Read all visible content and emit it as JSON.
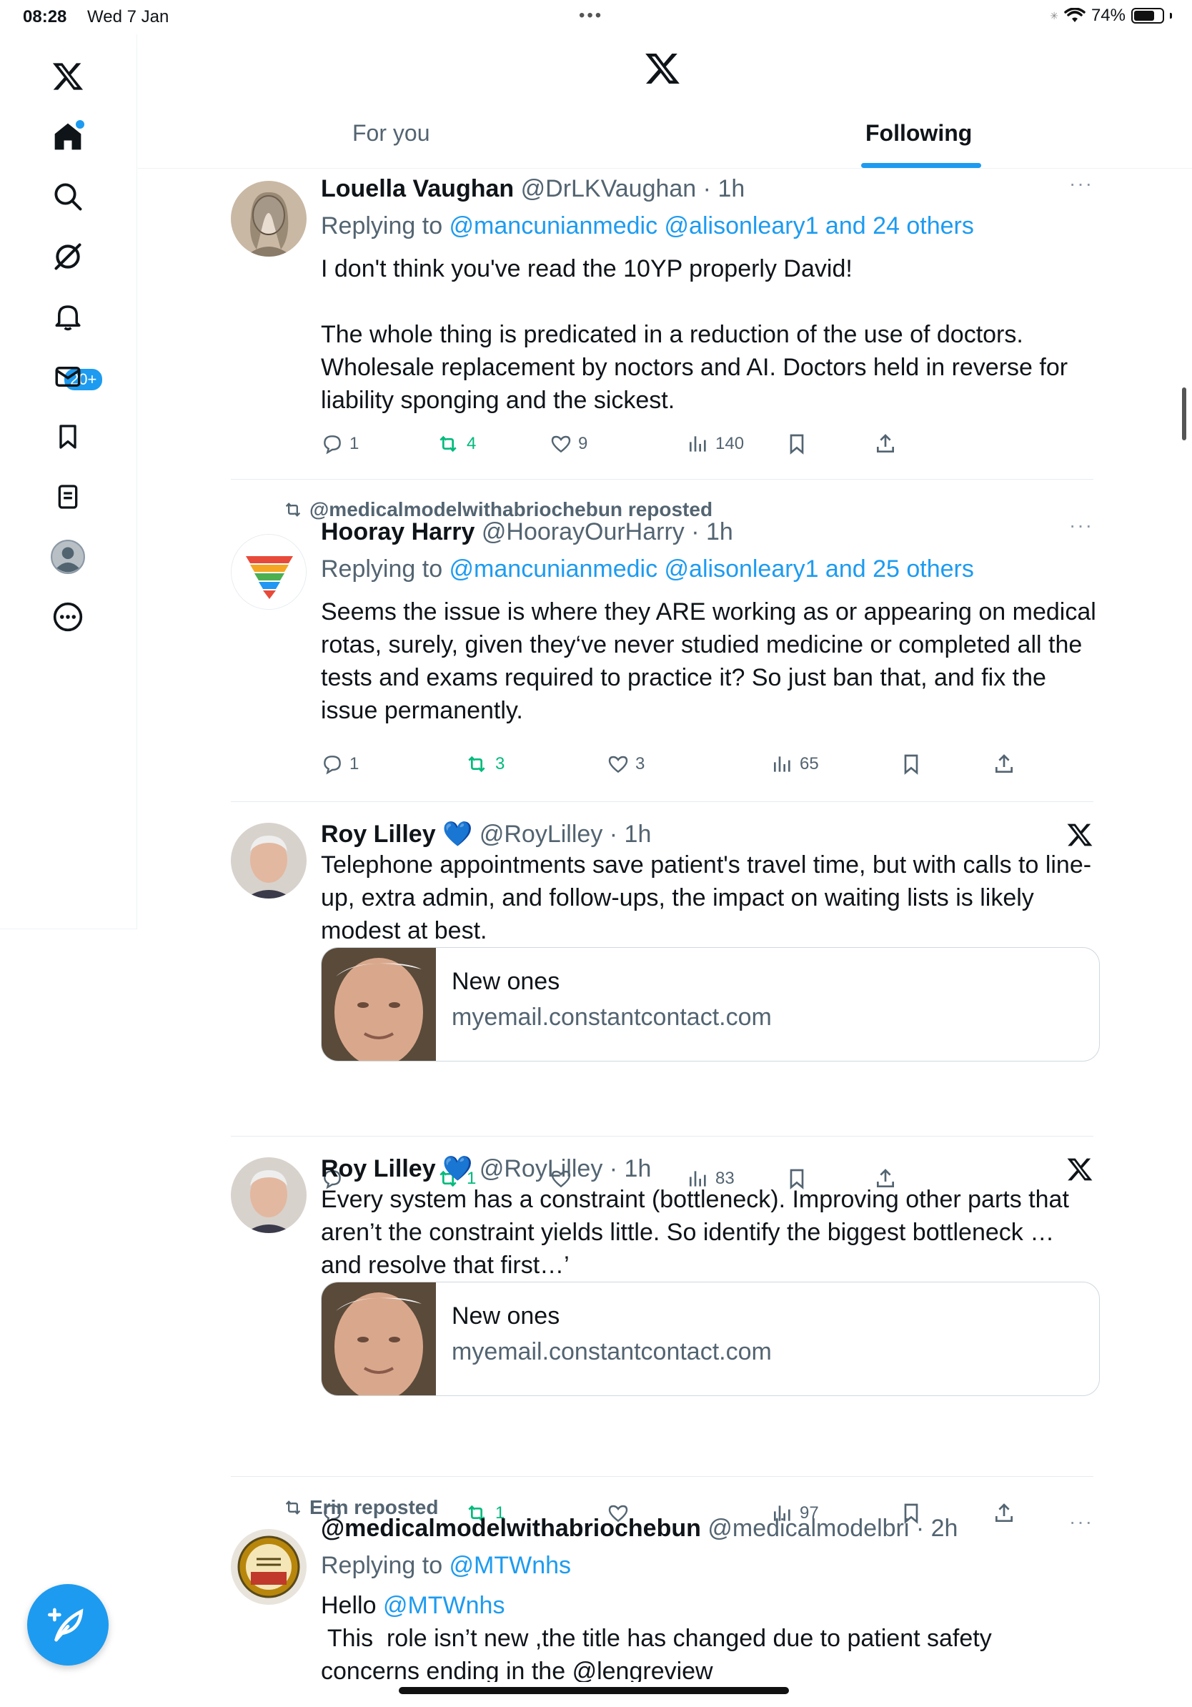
{
  "status_bar": {
    "time": "08:28",
    "date": "Wed 7 Jan",
    "battery": "74%",
    "battery_level": 0.74
  },
  "header": {
    "tabs": [
      {
        "label": "For you"
      },
      {
        "label": "Following"
      }
    ]
  },
  "sidebar": {
    "notifications_badge": "20+"
  },
  "tweets": [
    {
      "name": "Louella Vaughan",
      "handle": "@DrLKVaughan",
      "time": "· 1h",
      "reply_prefix": "Replying to ",
      "reply_to": "@mancunianmedic @alisonleary1 and 24 others",
      "text_p1": "I don't think you've read the 10YP properly David!",
      "text_p2": "The whole thing is predicated in a reduction of the use of doctors. Wholesale replacement by noctors and AI. Doctors held in reverse for liability sponging and the sickest.",
      "more": "···",
      "replies": "1",
      "reposts": "4",
      "likes": "9",
      "views": "140"
    },
    {
      "reposted_by": "@medicalmodelwithabriochebun reposted",
      "name": "Hooray Harry",
      "handle": "@HoorayOurHarry",
      "time": "· 1h",
      "reply_prefix": "Replying to ",
      "reply_to": "@mancunianmedic @alisonleary1 and 25 others",
      "text": "Seems the issue is where they ARE working as or appearing on medical rotas, surely, given they‘ve never studied medicine or completed all the tests and exams required to practice it? So just ban that, and fix the issue permanently.",
      "more": "···",
      "replies": "1",
      "reposts": "3",
      "likes": "3",
      "views": "65"
    },
    {
      "name": "Roy Lilley",
      "emoji": "💙",
      "handle": "@RoyLilley",
      "time": "· 1h",
      "text": "Telephone appointments save patient's travel time, but with calls to line-up, extra admin, and follow-ups, the impact on waiting lists is likely modest at best.",
      "card_title": "New ones",
      "card_domain": "myemail.constantcontact.com",
      "reposts": "1",
      "views": "83"
    },
    {
      "name": "Roy Lilley",
      "emoji": "💙",
      "handle": "@RoyLilley",
      "time": "· 1h",
      "text": "Every system has a constraint (bottleneck). Improving other parts that aren’t the constraint yields little. So identify the biggest bottleneck … and resolve that first…’",
      "card_title": "New ones",
      "card_domain": "myemail.constantcontact.com",
      "reposts": "1",
      "views": "97"
    },
    {
      "reposted_by": "Erin reposted",
      "name": "@medicalmodelwithabriochebun",
      "handle": "@medicalmodelbri",
      "time": "· 2h",
      "reply_prefix": "Replying to ",
      "reply_to": "@MTWnhs",
      "text_l1_prefix": "Hello ",
      "text_l1_link": "@MTWnhs",
      "text_l2": " This  role isn’t new ,the title has changed due to patient safety",
      "text_l3": "concerns ending in the @lengreview",
      "more": "···"
    }
  ]
}
